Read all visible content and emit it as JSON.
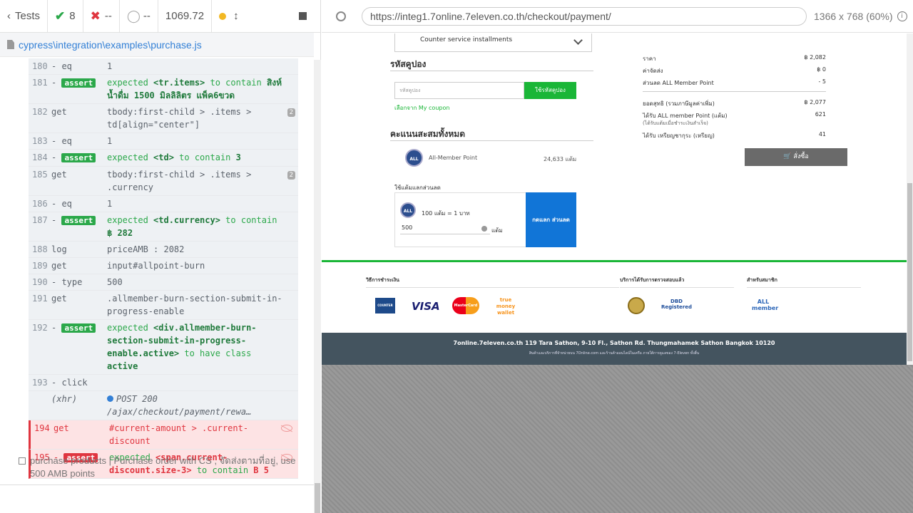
{
  "reporter": {
    "tests_label": "Tests",
    "passed": "8",
    "failed": "--",
    "pending": "--",
    "duration": "1069.72",
    "spec_path": "cypress\\integration\\examples\\purchase.js"
  },
  "commands": [
    {
      "num": "180",
      "name": "- eq",
      "msg": "1",
      "state": "normal"
    },
    {
      "num": "181",
      "name": "assert",
      "msg_parts": [
        "expected ",
        "<tr.items>",
        " to contain ",
        "สิงห์ น้ำดื่ม 1500 มิลลิลิตร แพ็ค6ขวด"
      ],
      "state": "assert"
    },
    {
      "num": "182",
      "name": "get",
      "msg": "tbody:first-child > .items > td[align=\"center\"]",
      "badge": "2",
      "state": "normal"
    },
    {
      "num": "183",
      "name": "- eq",
      "msg": "1",
      "state": "normal"
    },
    {
      "num": "184",
      "name": "assert",
      "msg_parts": [
        "expected ",
        "<td>",
        " to contain ",
        "3"
      ],
      "state": "assert"
    },
    {
      "num": "185",
      "name": "get",
      "msg": "tbody:first-child > .items > .currency",
      "badge": "2",
      "state": "normal"
    },
    {
      "num": "186",
      "name": "- eq",
      "msg": "1",
      "state": "normal"
    },
    {
      "num": "187",
      "name": "assert",
      "msg_parts": [
        "expected ",
        "<td.currency>",
        " to contain ",
        "฿ 282"
      ],
      "state": "assert"
    },
    {
      "num": "188",
      "name": "log",
      "msg": "priceAMB : 2082",
      "state": "normal"
    },
    {
      "num": "189",
      "name": "get",
      "msg": "input#allpoint-burn",
      "state": "normal"
    },
    {
      "num": "190",
      "name": "- type",
      "msg": "500",
      "state": "normal"
    },
    {
      "num": "191",
      "name": "get",
      "msg": ".allmember-burn-section-submit-in-progress-enable",
      "state": "normal"
    },
    {
      "num": "192",
      "name": "assert",
      "msg_parts": [
        "expected ",
        "<div.allmember-burn-section-submit-in-progress-enable.active>",
        " to have class ",
        "active"
      ],
      "state": "assert"
    },
    {
      "num": "193",
      "name": "- click",
      "msg": "",
      "state": "normal"
    },
    {
      "num": "",
      "name": "(xhr)",
      "msg": "POST 200 /ajax/checkout/payment/rewa…",
      "state": "xhr"
    },
    {
      "num": "194",
      "name": "get",
      "msg": "#current-amount > .current-discount",
      "state": "fail"
    },
    {
      "num": "195",
      "name": "assert",
      "msg_parts": [
        "expected ",
        "<span.current-discount.size-3>",
        " to contain ",
        "B 5"
      ],
      "state": "fail-assert"
    }
  ],
  "test_title": "purchase products | Purchase order with CS , จัดส่งตามที่อยู่, use 500 AMB points",
  "browser": {
    "url": "https://integ1.7online.7eleven.co.th/checkout/payment/",
    "viewport": "1366 x 768",
    "scale": "(60%)"
  },
  "app": {
    "installments_option": "Counter service installments",
    "coupon_title": "รหัสคูปอง",
    "coupon_placeholder": "รหัสคูปอง",
    "coupon_button": "ใช้รหัสคูปอง",
    "coupon_link": "เลือกจาก My coupon",
    "points_title": "คะแนนสะสมทั้งหมด",
    "points_logo": "ALL",
    "points_name": "All-Member Point",
    "points_value": "24,633 แต้ม",
    "burn_title": "ใช้แต้มแลกส่วนลด",
    "burn_rate": "100 แต้ม = 1 บาท",
    "burn_input": "500",
    "burn_unit": "แต้ม",
    "burn_button": "กดแลก ส่วนลด",
    "summary": [
      {
        "label": "ราคา",
        "value": "฿ 2,082"
      },
      {
        "label": "ค่าจัดส่ง",
        "value": "฿ 0"
      },
      {
        "label": "ส่วนลด ALL Member Point",
        "value": "- 5"
      },
      {
        "label": "ยอดสุทธิ (รวมภาษีมูลค่าเพิ่ม)",
        "value": "฿ 2,077"
      },
      {
        "label": "ได้รับ ALL member Point (แต้ม)",
        "value": "621"
      },
      {
        "label": "(ได้รับแต้มเมื่อชำระเงินสำเร็จ)",
        "value": ""
      },
      {
        "label": "ได้รับ เหรียญชากุระ (เหรียญ)",
        "value": "41"
      }
    ],
    "buy_button": "สั่งซื้อ",
    "footer": {
      "payment_title": "วิธีการชำระเงิน",
      "verified_title": "บริการได้รับการตรวจสอบแล้ว",
      "member_title": "สำหรับสมาชิก",
      "logos": [
        "COUNTER SERVICE",
        "VISA",
        "MasterCard",
        "true money wallet",
        "DBD Registered",
        "ALL member"
      ],
      "address": "7online.7eleven.co.th 119 Tara Sathon, 9-10 Fl., Sathon Rd. Thungmahamek Sathon Bangkok 10120",
      "disclaimer": "สินค้าและบริการที่จำหน่ายบน 7Online.com และร้านค้าออนไลน์ในเครือ ภายใต้การดูแลของ 7-Eleven ทั้งสิ้น"
    }
  }
}
